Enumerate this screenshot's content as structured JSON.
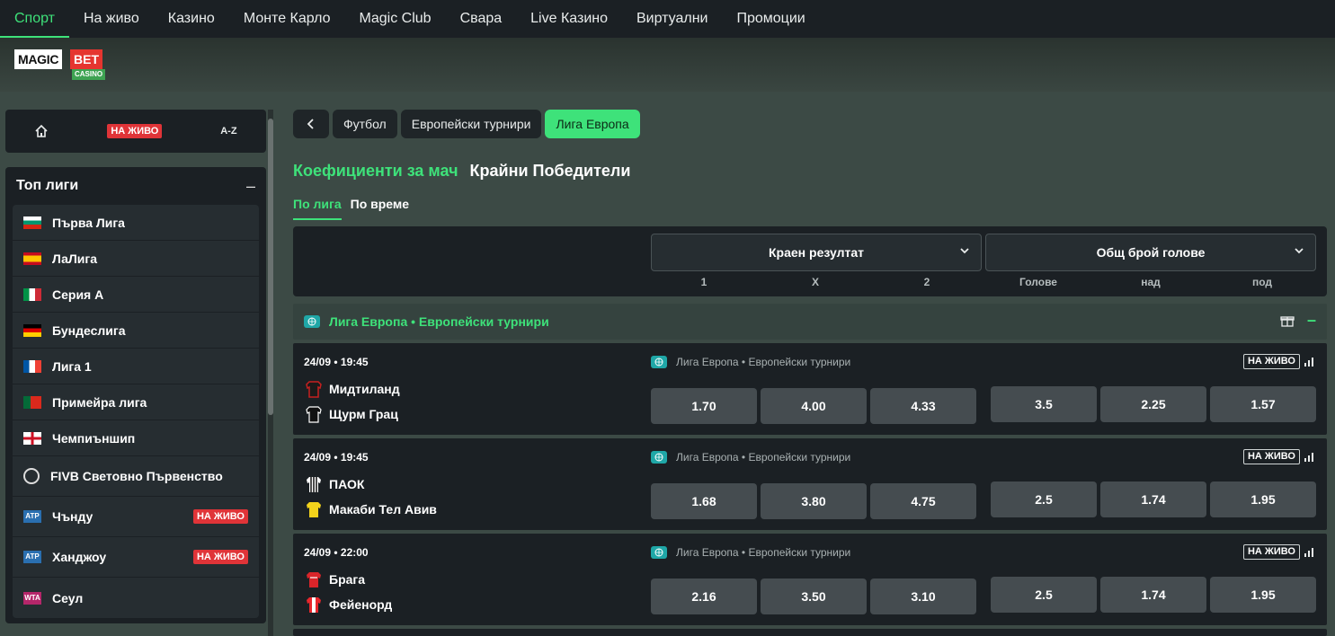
{
  "topnav": [
    "Спорт",
    "На живо",
    "Казино",
    "Монте Карло",
    "Magic Club",
    "Свара",
    "Live Казино",
    "Виртуални",
    "Промоции"
  ],
  "logo": {
    "magic": "MAGIC",
    "bet": "BET",
    "casino": "CASINO"
  },
  "side_top": {
    "live": "НА ЖИВО",
    "az": "A-Z"
  },
  "top_leagues": {
    "title": "Топ лиги",
    "items": [
      {
        "label": "Първа Лига",
        "flag": "bulgaria",
        "live": ""
      },
      {
        "label": "ЛаЛига",
        "flag": "spain",
        "live": ""
      },
      {
        "label": "Серия А",
        "flag": "italy",
        "live": ""
      },
      {
        "label": "Бундеслига",
        "flag": "germany",
        "live": ""
      },
      {
        "label": "Лига 1",
        "flag": "france",
        "live": ""
      },
      {
        "label": "Примейра лига",
        "flag": "portugal",
        "live": ""
      },
      {
        "label": "Чемпиъншип",
        "flag": "england",
        "live": ""
      },
      {
        "label": "FIVB Световно Първенство",
        "flag": "volleyball",
        "live": ""
      },
      {
        "label": "Чънду",
        "flag": "atp",
        "live": "НА ЖИВО"
      },
      {
        "label": "Ханджоу",
        "flag": "atp",
        "live": "НА ЖИВО"
      },
      {
        "label": "Сеул",
        "flag": "wta",
        "live": ""
      }
    ]
  },
  "breadcrumb": [
    "Футбол",
    "Европейски турнири",
    "Лига Европа"
  ],
  "heading": {
    "green": "Коефициенти за мач",
    "white": "Крайни Победители"
  },
  "subtabs": [
    "По лига",
    "По време"
  ],
  "markets": {
    "result_label": "Краен резултат",
    "goals_label": "Общ брой голове",
    "result_cols": [
      "1",
      "X",
      "2"
    ],
    "goals_cols": [
      "Голове",
      "над",
      "под"
    ]
  },
  "group_title": "Лига Европа • Европейски турнири",
  "matches": [
    {
      "datetime": "24/09 • 19:45",
      "home": "Мидтиланд",
      "away": "Щурм Грац",
      "league": "Лига Европа • Европейски турнири",
      "live": "НА ЖИВО",
      "odds": [
        "1.70",
        "4.00",
        "4.33"
      ],
      "goals": [
        "3.5",
        "2.25",
        "1.57"
      ],
      "home_color": "#1a1a1a",
      "away_color": "#111111"
    },
    {
      "datetime": "24/09 • 19:45",
      "home": "ПАОК",
      "away": "Макаби Тел Авив",
      "league": "Лига Европа • Европейски турнири",
      "live": "НА ЖИВО",
      "odds": [
        "1.68",
        "3.80",
        "4.75"
      ],
      "goals": [
        "2.5",
        "1.74",
        "1.95"
      ],
      "home_color": "#ffffff",
      "away_color": "#f2d21b"
    },
    {
      "datetime": "24/09 • 22:00",
      "home": "Брага",
      "away": "Фейенорд",
      "league": "Лига Европа • Европейски турнири",
      "live": "НА ЖИВО",
      "odds": [
        "2.16",
        "3.50",
        "3.10"
      ],
      "goals": [
        "2.5",
        "1.74",
        "1.95"
      ],
      "home_color": "#d9252a",
      "away_color": "#e8262c"
    }
  ],
  "colors": {
    "accent": "#3ee27a",
    "live": "#e03438",
    "panel": "#1b2024",
    "odd_bg": "#454c50"
  }
}
